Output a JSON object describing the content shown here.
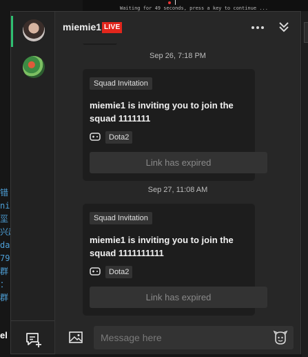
{
  "background": {
    "terminal_text": "Waiting for 49 seconds, press a key to continue ...",
    "left_fragments": [
      "错",
      "ni",
      "坙",
      "兴起",
      "da",
      "79",
      "群",
      "：",
      "群"
    ],
    "left_bottom_text": "el"
  },
  "header": {
    "username": "miemie1",
    "live_label": "LIVE"
  },
  "messages": [
    {
      "timestamp": "Sep 26, 7:18 PM",
      "tag": "Squad Invitation",
      "text": "miemie1 is inviting you to join the squad 1111111",
      "game": "Dota2",
      "action": "Link has expired"
    },
    {
      "timestamp": "Sep 27, 11:08 AM",
      "tag": "Squad Invitation",
      "text": "miemie1 is inviting you to join the squad 1111111111",
      "game": "Dota2",
      "action": "Link has expired"
    }
  ],
  "composer": {
    "placeholder": "Message here"
  },
  "colors": {
    "live": "#e2261c",
    "active_indicator": "#2fbf71"
  }
}
